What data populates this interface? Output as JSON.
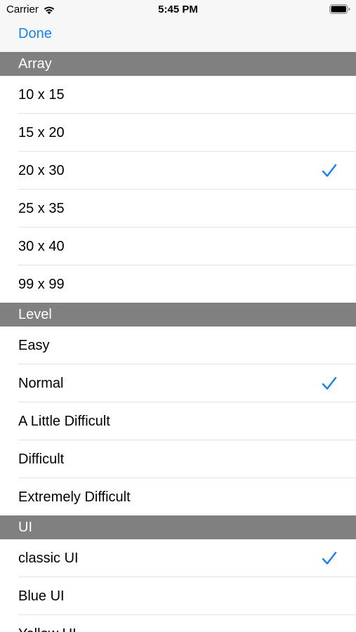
{
  "status_bar": {
    "carrier": "Carrier",
    "time": "5:45 PM",
    "wifi_icon": "wifi-icon",
    "battery_icon": "battery-icon"
  },
  "nav": {
    "done_label": "Done"
  },
  "colors": {
    "accent": "#1a82f0",
    "section_header_bg": "#808080",
    "bar_bg": "#f7f7f7"
  },
  "sections": [
    {
      "title": "Array",
      "items": [
        {
          "label": "10 x 15",
          "checked": false
        },
        {
          "label": "15 x 20",
          "checked": false
        },
        {
          "label": "20 x 30",
          "checked": true
        },
        {
          "label": "25 x 35",
          "checked": false
        },
        {
          "label": "30 x 40",
          "checked": false
        },
        {
          "label": "99 x 99",
          "checked": false
        }
      ]
    },
    {
      "title": "Level",
      "items": [
        {
          "label": "Easy",
          "checked": false
        },
        {
          "label": "Normal",
          "checked": true
        },
        {
          "label": "A Little Difficult",
          "checked": false
        },
        {
          "label": "Difficult",
          "checked": false
        },
        {
          "label": "Extremely Difficult",
          "checked": false
        }
      ]
    },
    {
      "title": "UI",
      "items": [
        {
          "label": "classic UI",
          "checked": true
        },
        {
          "label": "Blue UI",
          "checked": false
        },
        {
          "label": "Yellow UI",
          "checked": false
        }
      ]
    }
  ]
}
